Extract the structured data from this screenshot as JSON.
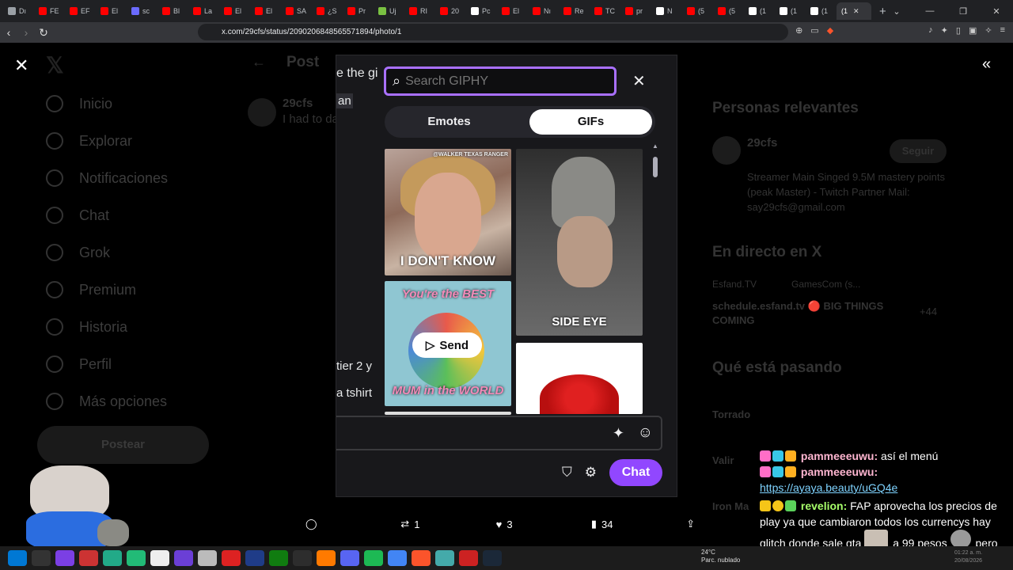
{
  "browser": {
    "tabs": [
      {
        "label": "Dı",
        "color": "#9aa0a6"
      },
      {
        "label": "FE",
        "color": "#ff0000"
      },
      {
        "label": "EF",
        "color": "#ff0000"
      },
      {
        "label": "El",
        "color": "#ff0000"
      },
      {
        "label": "sc",
        "color": "#6b6bff"
      },
      {
        "label": "Bl",
        "color": "#ff0000"
      },
      {
        "label": "La",
        "color": "#ff0000"
      },
      {
        "label": "El",
        "color": "#ff0000"
      },
      {
        "label": "El",
        "color": "#ff0000"
      },
      {
        "label": "SA",
        "color": "#ff0000"
      },
      {
        "label": "¿S",
        "color": "#ff0000"
      },
      {
        "label": "Pr",
        "color": "#ff0000"
      },
      {
        "label": "Uj",
        "color": "#7ac142"
      },
      {
        "label": "RI",
        "color": "#ff0000"
      },
      {
        "label": "20",
        "color": "#ff0000"
      },
      {
        "label": "Pc",
        "color": "#ffffff"
      },
      {
        "label": "El",
        "color": "#ff0000"
      },
      {
        "label": "Nı",
        "color": "#ff0000"
      },
      {
        "label": "Re",
        "color": "#ff0000"
      },
      {
        "label": "TC",
        "color": "#ff0000"
      },
      {
        "label": "pr",
        "color": "#ff0000"
      },
      {
        "label": "N",
        "color": "#ffffff"
      },
      {
        "label": "(5",
        "color": "#ff0000"
      },
      {
        "label": "(5",
        "color": "#ff0000"
      },
      {
        "label": "(1",
        "color": "#ffffff"
      },
      {
        "label": "(1",
        "color": "#ffffff"
      },
      {
        "label": "(1",
        "color": "#ffffff"
      }
    ],
    "active_tab": {
      "label": "(1",
      "close": "✕"
    },
    "new_tab": "+",
    "url": "x.com/29cfs/status/2090206848565571894/photo/1"
  },
  "page": {
    "close_icon": "✕",
    "x_logo": "𝕏",
    "nav": [
      "Inicio",
      "Explorar",
      "Notificaciones",
      "Chat",
      "Grok",
      "Premium",
      "Historia",
      "Perfil",
      "Más opciones"
    ],
    "post_button": "Postear",
    "post_header": "Post",
    "author": "29cfs",
    "tweet_snippet": "I had to da",
    "right": {
      "relevant_title": "Personas relevantes",
      "person_name": "29cfs",
      "follow": "Seguir",
      "bio": "Streamer Main Singed 9.5M mastery points (peak Master) - Twitch Partner Mail: say29cfs@gmail.com",
      "live_title": "En directo en X",
      "live_host": "Esfand.TV",
      "live_event": "GamesCom (s...",
      "live_text": "schedule.esfand.tv 🔴 BIG THINGS COMING",
      "live_count": "+44",
      "trending_title": "Qué está pasando",
      "trend1": "Torrado",
      "trend2": "Valir",
      "trend3": "Iron Ma"
    },
    "actions": {
      "replies": "",
      "retweets": "1",
      "likes": "3",
      "views": "34"
    }
  },
  "giphy": {
    "search_placeholder": "Search GIPHY",
    "tabs": {
      "emotes": "Emotes",
      "gifs": "GIFs"
    },
    "gif1_caption": "I DON'T KNOW",
    "gif1_watermark": "@WALKER TEXAS RANGER",
    "gif2_caption": "SIDE EYE",
    "gif3_top": "You're the BEST",
    "gif3_bottom": "MUM in the WORLD",
    "send_label": "Send",
    "chat_button": "Chat",
    "bg_fragment1": "e the gi",
    "bg_fragment2": "an",
    "bg_fragment3": "tier 2 y",
    "bg_fragment4": "a tshirt"
  },
  "chat_overlay": {
    "msg1_user": "pammeeeuwu:",
    "msg1_text": "así el menú",
    "msg2_user": "pammeeeuwu:",
    "msg2_link": "https://ayaya.beauty/uGQ4e",
    "msg3_user": "revelion:",
    "msg3_text": "FAP aprovecha los precios de play ya que cambiaron todos los currencys hay glitch donde sale gta",
    "msg3_text2": "a 99 pesos",
    "msg3_text3": "pero todavía no se pueden comprar"
  },
  "taskbar": {
    "temp": "24°C",
    "weather": "Parc. nublado",
    "clock": "01:22 a. m.",
    "date": "20/08/2026"
  },
  "colors": {
    "twitch_purple": "#9147ff",
    "search_border": "#a970ff"
  }
}
